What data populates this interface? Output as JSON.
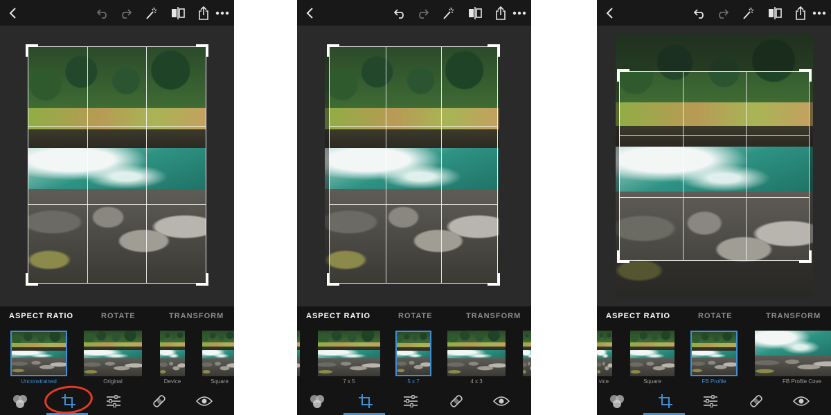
{
  "panels": [
    {
      "id": "panel-1",
      "tabs": [
        {
          "label": "ASPECT RATIO",
          "active": true
        },
        {
          "label": "ROTATE",
          "active": false
        },
        {
          "label": "TRANSFORM",
          "active": false
        }
      ],
      "thumbnails": [
        {
          "label": "Unconstrained",
          "selected": true
        },
        {
          "label": "Original",
          "selected": false
        },
        {
          "label": "Device",
          "selected": false
        },
        {
          "label": "Square",
          "selected": false
        }
      ],
      "active_tool": "crop",
      "annotation": "red circle around crop tool"
    },
    {
      "id": "panel-2",
      "tabs": [
        {
          "label": "ASPECT RATIO",
          "active": true
        },
        {
          "label": "ROTATE",
          "active": false
        },
        {
          "label": "TRANSFORM",
          "active": false
        }
      ],
      "thumbnails": [
        {
          "label": "7 x 5",
          "selected": false
        },
        {
          "label": "5 x 7",
          "selected": true
        },
        {
          "label": "4 x 3",
          "selected": false
        }
      ],
      "active_tool": "crop"
    },
    {
      "id": "panel-3",
      "tabs": [
        {
          "label": "ASPECT RATIO",
          "active": true
        },
        {
          "label": "ROTATE",
          "active": false
        },
        {
          "label": "TRANSFORM",
          "active": false
        }
      ],
      "thumbnails": [
        {
          "label": "vice",
          "selected": false
        },
        {
          "label": "Square",
          "selected": false
        },
        {
          "label": "FB Profile",
          "selected": true
        },
        {
          "label": "FB Profile Cove",
          "selected": false
        }
      ],
      "active_tool": "crop"
    }
  ],
  "icons": {
    "top": [
      "back-icon",
      "undo-icon",
      "redo-icon",
      "magic-wand-icon",
      "compare-icon",
      "share-icon",
      "more-icon"
    ],
    "bottom": [
      "looks-icon",
      "crop-icon",
      "adjust-icon",
      "heal-icon",
      "eye-icon"
    ]
  },
  "colors": {
    "accent": "#3f8fd4",
    "annotation": "#e23b22",
    "toolbar": "#141414",
    "canvas": "#2a2a2a"
  }
}
